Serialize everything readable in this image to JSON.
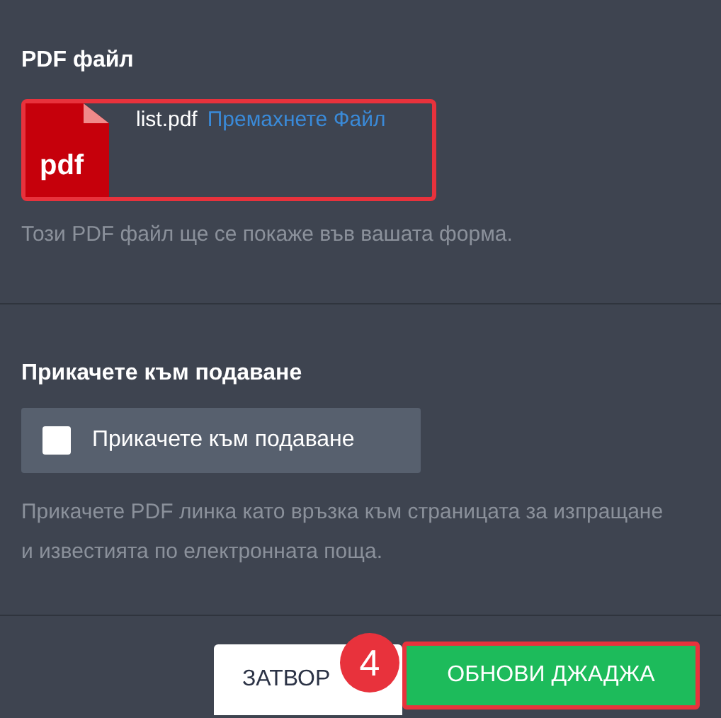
{
  "pdf_section": {
    "title": "PDF файл",
    "file": {
      "icon_label": "pdf",
      "name": "list.pdf",
      "remove_link": "Премахнете Файл"
    },
    "help": "Този PDF файл ще се покаже във вашата форма."
  },
  "attach_section": {
    "title": "Прикачете към подаване",
    "checkbox": {
      "label": "Прикачете към подаване",
      "checked": false
    },
    "help": "Прикачете PDF линка като връзка към страницата за изпращане и известията по електронната поща."
  },
  "footer": {
    "buttons": [
      {
        "label": "ЗАТВОР",
        "kind": "secondary"
      },
      {
        "label": "ОБНОВИ ДЖАДЖА",
        "kind": "primary"
      }
    ],
    "step_badge": "4"
  }
}
